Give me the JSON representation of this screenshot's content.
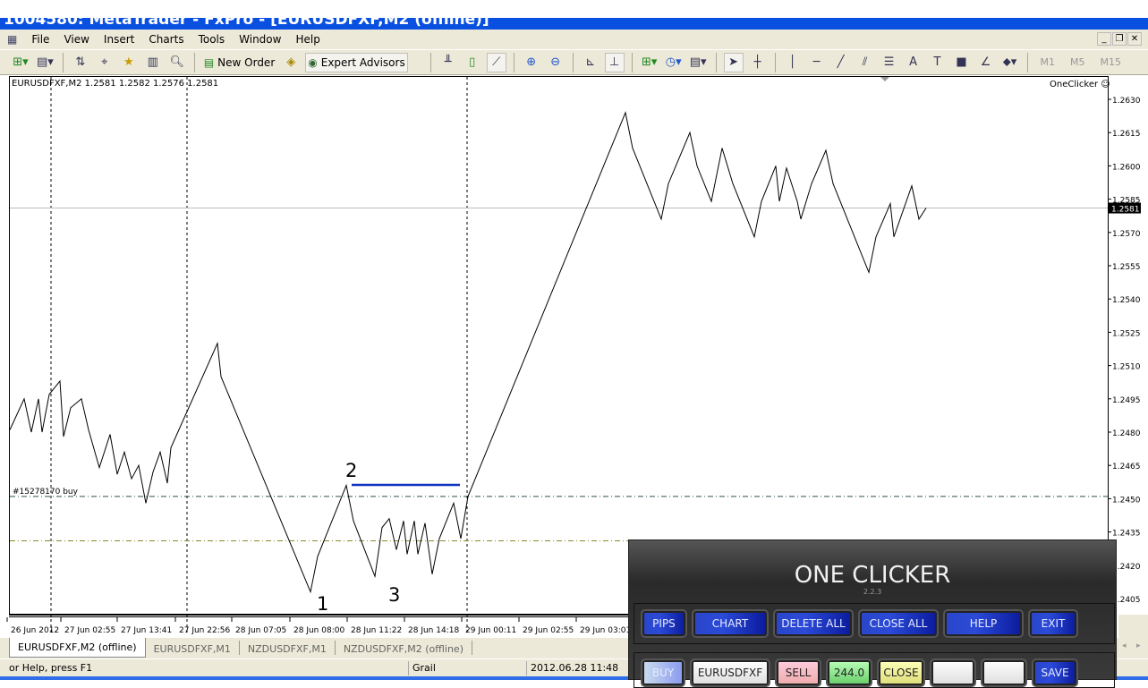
{
  "window": {
    "title": "1004580: MetaTrader - FxPro - [EURUSDFXF,M2 (offline)]"
  },
  "menu": [
    "File",
    "View",
    "Insert",
    "Charts",
    "Tools",
    "Window",
    "Help"
  ],
  "toolbar": {
    "new_order": "New Order",
    "expert_advisors": "Expert Advisors",
    "timeframes": [
      "M1",
      "M5",
      "M15"
    ]
  },
  "chart": {
    "info": "EURUSDFXF,M2  1.2581 1.2582 1.2576 1.2581",
    "indicator_label": "OneClicker",
    "current_price": "1.2581",
    "order_label": "#15278170 buy",
    "annotations": [
      "1",
      "2",
      "3"
    ],
    "line_color": "#000000",
    "order_line_color": "#2f4f4f",
    "second_line_color": "#8b8b2a",
    "marker_line_color": "#1030c0"
  },
  "chart_data": {
    "type": "line",
    "ylim": [
      1.24,
      1.264
    ],
    "price_ticks": [
      "1.2630",
      "1.2615",
      "1.2600",
      "1.2585",
      "1.2570",
      "1.2555",
      "1.2540",
      "1.2525",
      "1.2510",
      "1.2495",
      "1.2480",
      "1.2465",
      "1.2450",
      "1.2435",
      "1.2420",
      "1.2405"
    ],
    "time_ticks": [
      "26 Jun 2012",
      "27 Jun 02:55",
      "27 Jun 13:41",
      "27 Jun 22:56",
      "28 Jun 07:05",
      "28 Jun 08:00",
      "28 Jun 11:22",
      "28 Jun 14:18",
      "29 Jun 00:11",
      "29 Jun 02:55",
      "29 Jun 03:01"
    ],
    "bid": 1.2581,
    "order_price": 1.2451,
    "second_level": 1.2431,
    "points": [
      [
        0,
        1.2481
      ],
      [
        4,
        1.2495
      ],
      [
        6,
        1.248
      ],
      [
        8,
        1.2495
      ],
      [
        9,
        1.248
      ],
      [
        11,
        1.2497
      ],
      [
        14,
        1.2503
      ],
      [
        15,
        1.2478
      ],
      [
        17,
        1.2491
      ],
      [
        20,
        1.2495
      ],
      [
        22,
        1.2481
      ],
      [
        25,
        1.2464
      ],
      [
        28,
        1.2479
      ],
      [
        30,
        1.2461
      ],
      [
        32,
        1.2471
      ],
      [
        34,
        1.2459
      ],
      [
        36,
        1.2465
      ],
      [
        38,
        1.2448
      ],
      [
        40,
        1.2462
      ],
      [
        42,
        1.2471
      ],
      [
        44,
        1.2457
      ],
      [
        45,
        1.2473
      ],
      [
        58,
        1.252
      ],
      [
        59,
        1.2505
      ],
      [
        84,
        1.2408
      ],
      [
        86,
        1.2424
      ],
      [
        94,
        1.2456
      ],
      [
        96,
        1.244
      ],
      [
        102,
        1.2415
      ],
      [
        104,
        1.2437
      ],
      [
        106,
        1.2441
      ],
      [
        108,
        1.2427
      ],
      [
        110,
        1.244
      ],
      [
        111,
        1.2425
      ],
      [
        113,
        1.244
      ],
      [
        114,
        1.2425
      ],
      [
        116,
        1.2439
      ],
      [
        118,
        1.2416
      ],
      [
        120,
        1.2432
      ],
      [
        124,
        1.2448
      ],
      [
        126,
        1.2432
      ],
      [
        128,
        1.2451
      ],
      [
        172,
        1.2624
      ],
      [
        174,
        1.2608
      ],
      [
        182,
        1.2576
      ],
      [
        184,
        1.2592
      ],
      [
        190,
        1.2615
      ],
      [
        192,
        1.26
      ],
      [
        196,
        1.2584
      ],
      [
        199,
        1.2608
      ],
      [
        202,
        1.2592
      ],
      [
        208,
        1.2568
      ],
      [
        210,
        1.2584
      ],
      [
        214,
        1.26
      ],
      [
        215,
        1.2584
      ],
      [
        217,
        1.2599
      ],
      [
        220,
        1.2584
      ],
      [
        221,
        1.2576
      ],
      [
        224,
        1.2592
      ],
      [
        228,
        1.2607
      ],
      [
        230,
        1.2592
      ],
      [
        240,
        1.2552
      ],
      [
        242,
        1.2568
      ],
      [
        246,
        1.2583
      ],
      [
        247,
        1.2568
      ],
      [
        252,
        1.2591
      ],
      [
        254,
        1.2576
      ],
      [
        256,
        1.2581
      ]
    ]
  },
  "tabs": [
    "EURUSDFXF,M2 (offline)",
    "EURUSDFXF,M1",
    "NZDUSDFXF,M1",
    "NZDUSDFXF,M2 (offline)"
  ],
  "status": {
    "help": "or Help, press F1",
    "profile": "Grail",
    "datetime": "2012.06.28 11:48"
  },
  "oneclicker": {
    "title": "ONE CLICKER",
    "version": "2.2.3",
    "row1": [
      "PIPS",
      "CHART",
      "DELETE ALL",
      "CLOSE ALL",
      "HELP",
      "EXIT"
    ],
    "row2": [
      "BUY",
      "EURUSDFXF",
      "SELL",
      "244.0",
      "CLOSE",
      "",
      "",
      "SAVE"
    ]
  }
}
